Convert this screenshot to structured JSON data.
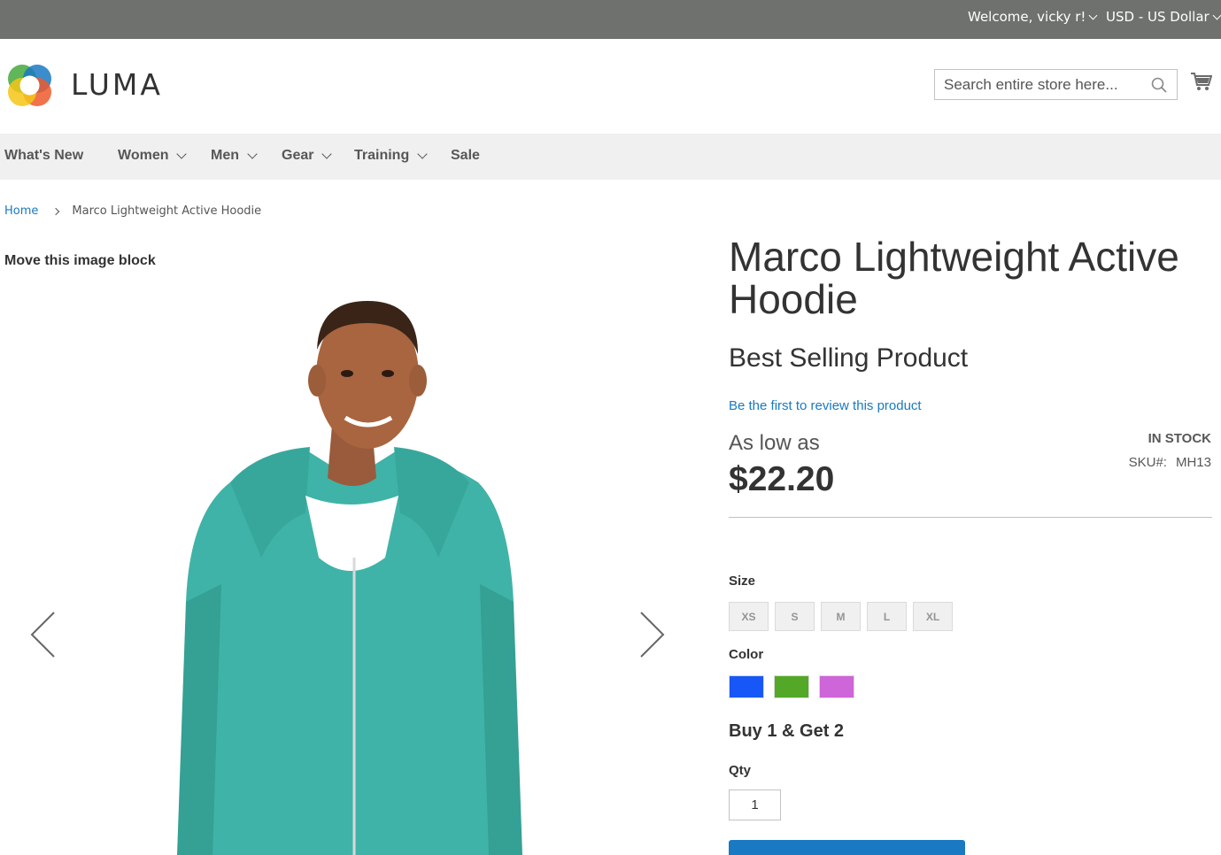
{
  "topbar": {
    "welcome": "Welcome, vicky r!",
    "currency": "USD - US Dollar"
  },
  "header": {
    "logo_text": "LUMA",
    "search_placeholder": "Search entire store here..."
  },
  "nav": {
    "items": [
      {
        "label": "What's New",
        "has_dropdown": false
      },
      {
        "label": "Women",
        "has_dropdown": true
      },
      {
        "label": "Men",
        "has_dropdown": true
      },
      {
        "label": "Gear",
        "has_dropdown": true
      },
      {
        "label": "Training",
        "has_dropdown": true
      },
      {
        "label": "Sale",
        "has_dropdown": false
      }
    ]
  },
  "breadcrumb": {
    "home": "Home",
    "current": "Marco Lightweight Active Hoodie"
  },
  "gallery": {
    "heading": "Move this image block"
  },
  "product": {
    "title": "Marco Lightweight Active Hoodie",
    "tagline": "Best Selling Product",
    "review_link": "Be the first to review this product",
    "price_prefix": "As low as",
    "price": "$22.20",
    "stock": "IN STOCK",
    "sku_label": "SKU#:",
    "sku": "MH13"
  },
  "options": {
    "size_label": "Size",
    "sizes": [
      "XS",
      "S",
      "M",
      "L",
      "XL"
    ],
    "color_label": "Color",
    "colors": [
      "#1857f7",
      "#53a828",
      "#ce65d8"
    ],
    "promo": "Buy 1 & Get 2",
    "qty_label": "Qty",
    "qty_value": "1"
  }
}
